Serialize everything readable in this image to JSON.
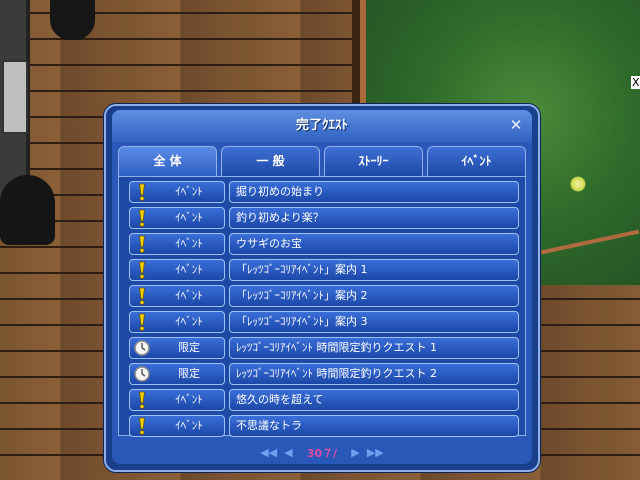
{
  "dialog": {
    "title": "完了ｸｴｽﾄ",
    "close_glyph": "✕"
  },
  "tabs": [
    {
      "label": "全 体",
      "active": true
    },
    {
      "label": "一 般",
      "active": false
    },
    {
      "label": "ｽﾄｰﾘｰ",
      "active": false
    },
    {
      "label": "ｲﾍﾞﾝﾄ",
      "active": false
    }
  ],
  "quests": [
    {
      "icon": "exclamation-icon",
      "category": "ｲﾍﾞﾝﾄ",
      "name": "掘り初めの始まり"
    },
    {
      "icon": "exclamation-icon",
      "category": "ｲﾍﾞﾝﾄ",
      "name": "釣り初めより楽？"
    },
    {
      "icon": "exclamation-icon",
      "category": "ｲﾍﾞﾝﾄ",
      "name": "ウサギのお宝"
    },
    {
      "icon": "exclamation-icon",
      "category": "ｲﾍﾞﾝﾄ",
      "name": "「ﾚｯﾂｺﾞｰｺﾘｱｲﾍﾞﾝﾄ」案内 1"
    },
    {
      "icon": "exclamation-icon",
      "category": "ｲﾍﾞﾝﾄ",
      "name": "「ﾚｯﾂｺﾞｰｺﾘｱｲﾍﾞﾝﾄ」案内 2"
    },
    {
      "icon": "exclamation-icon",
      "category": "ｲﾍﾞﾝﾄ",
      "name": "「ﾚｯﾂｺﾞｰｺﾘｱｲﾍﾞﾝﾄ」案内 3"
    },
    {
      "icon": "clock-icon",
      "category": "限定",
      "name": "ﾚｯﾂｺﾞｰｺﾘｱｲﾍﾞﾝﾄ 時間限定釣りクエスト 1"
    },
    {
      "icon": "clock-icon",
      "category": "限定",
      "name": "ﾚｯﾂｺﾞｰｺﾘｱｲﾍﾞﾝﾄ 時間限定釣りクエスト 2"
    },
    {
      "icon": "exclamation-icon",
      "category": "ｲﾍﾞﾝﾄ",
      "name": "悠久の時を超えて"
    },
    {
      "icon": "exclamation-icon",
      "category": "ｲﾍﾞﾝﾄ",
      "name": "不思議なトラ"
    }
  ],
  "pager": {
    "first_glyph": "◀◀",
    "prev_glyph": "◀",
    "page": "30７/",
    "next_glyph": "▶",
    "last_glyph": "▶▶"
  },
  "scene": {
    "offscreen_label": "X"
  },
  "colors": {
    "dialog_bg": "#1a3f8c",
    "row_bg": "#2b5fc8",
    "page_number": "#e04aa8",
    "exclamation": "#f5d000"
  }
}
